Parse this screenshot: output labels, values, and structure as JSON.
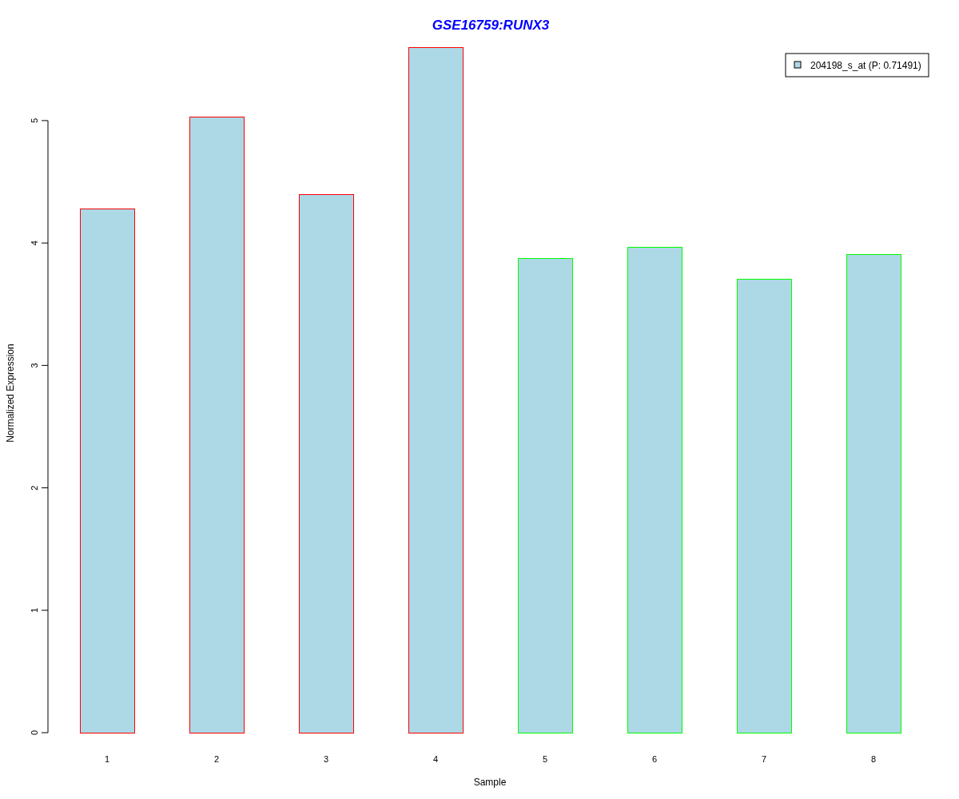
{
  "chart_data": {
    "type": "bar",
    "title": "GSE16759:RUNX3",
    "xlabel": "Sample",
    "ylabel": "Normalized Expression",
    "categories": [
      "1",
      "2",
      "3",
      "4",
      "5",
      "6",
      "7",
      "8"
    ],
    "series": [
      {
        "name": "204198_s_at (P: 0.71491)",
        "color": "#add8e6",
        "values": [
          4.28,
          5.03,
          4.4,
          5.6,
          3.88,
          3.97,
          3.71,
          3.91
        ]
      }
    ],
    "ylim": [
      0,
      5.6
    ],
    "yticks": [
      0,
      1,
      2,
      3,
      4,
      5
    ]
  },
  "bar_borders": [
    {
      "color": "#ff0000"
    },
    {
      "color": "#ff0000"
    },
    {
      "color": "#ff0000"
    },
    {
      "color": "#ff0000"
    },
    {
      "color": "#00ff00"
    },
    {
      "color": "#00ff00"
    },
    {
      "color": "#00ff00"
    },
    {
      "color": "#00ff00"
    }
  ]
}
